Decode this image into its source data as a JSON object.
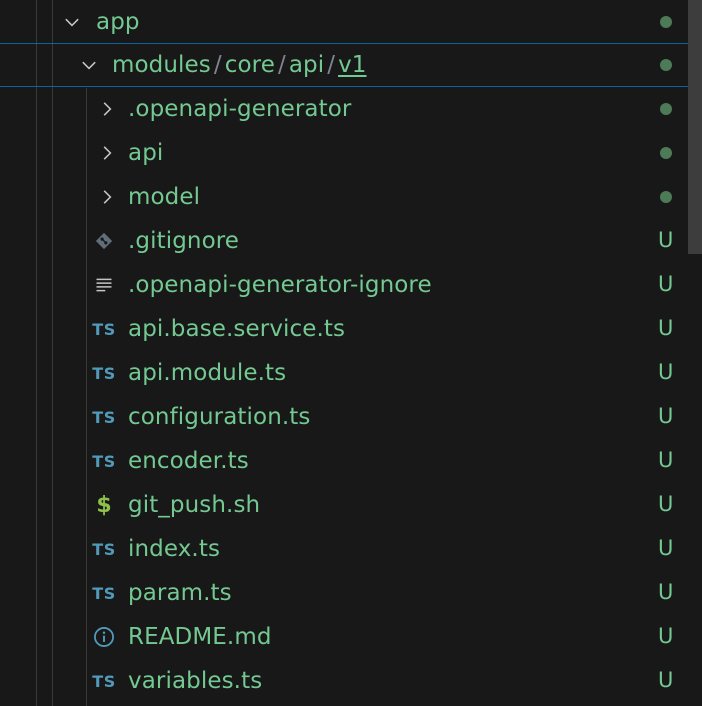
{
  "explorer": {
    "root": {
      "label": "app",
      "status": "dot"
    },
    "compact_folder": {
      "segments": [
        "modules",
        "core",
        "api",
        "v1"
      ],
      "separator": "/",
      "status": "dot"
    },
    "folders": [
      {
        "label": ".openapi-generator",
        "status": "dot"
      },
      {
        "label": "api",
        "status": "dot"
      },
      {
        "label": "model",
        "status": "dot"
      }
    ],
    "files": [
      {
        "label": ".gitignore",
        "icon": "git-diamond-icon",
        "status": "U"
      },
      {
        "label": ".openapi-generator-ignore",
        "icon": "lines-icon",
        "status": "U"
      },
      {
        "label": "api.base.service.ts",
        "icon": "TS",
        "status": "U"
      },
      {
        "label": "api.module.ts",
        "icon": "TS",
        "status": "U"
      },
      {
        "label": "configuration.ts",
        "icon": "TS",
        "status": "U"
      },
      {
        "label": "encoder.ts",
        "icon": "TS",
        "status": "U"
      },
      {
        "label": "git_push.sh",
        "icon": "$",
        "status": "U"
      },
      {
        "label": "index.ts",
        "icon": "TS",
        "status": "U"
      },
      {
        "label": "param.ts",
        "icon": "TS",
        "status": "U"
      },
      {
        "label": "README.md",
        "icon": "info-icon",
        "status": "U"
      },
      {
        "label": "variables.ts",
        "icon": "TS",
        "status": "U"
      }
    ]
  },
  "colors": {
    "background": "#181818",
    "untracked_text": "#73c991",
    "status_dot": "#4d7a57",
    "focus_border": "#0e639c",
    "ts_icon": "#519aba",
    "shell_icon": "#8dc149",
    "indent_guide": "#3a3a3a"
  }
}
